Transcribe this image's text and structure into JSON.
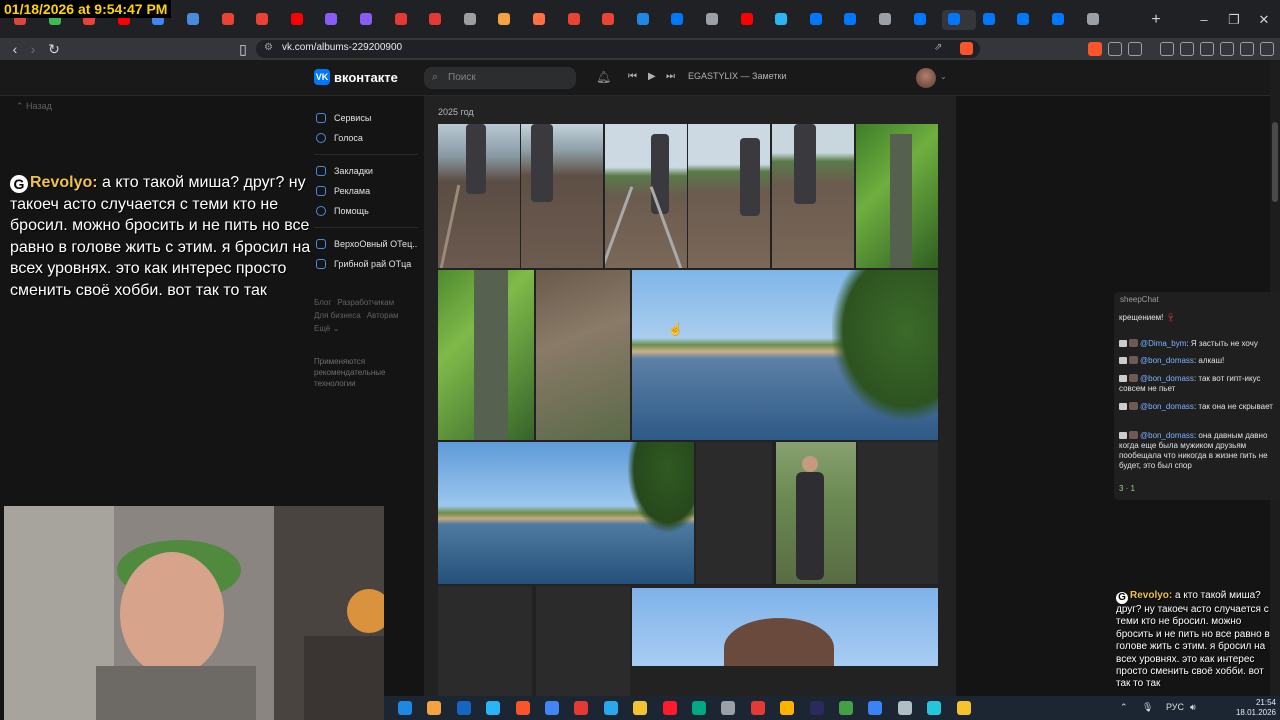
{
  "overlay_timestamp": "01/18/2026 at 9:54:47 PM",
  "browser": {
    "url": "vk.com/albums-229200900",
    "tabs": [
      {
        "color": "#d9483b"
      },
      {
        "color": "#3fb950"
      },
      {
        "color": "#ea4335"
      },
      {
        "color": "#ff0000"
      },
      {
        "color": "#4285f4"
      },
      {
        "color": "#4a8cdc"
      },
      {
        "color": "#ea4335"
      },
      {
        "color": "#ea4335"
      },
      {
        "color": "#ff0000"
      },
      {
        "color": "#8a5cf6"
      },
      {
        "color": "#8a5cf6"
      },
      {
        "color": "#e53935"
      },
      {
        "color": "#e53935"
      },
      {
        "color": "#9e9e9e"
      },
      {
        "color": "#f4a340"
      },
      {
        "color": "#ff7043"
      },
      {
        "color": "#ea4335"
      },
      {
        "color": "#ea4335"
      },
      {
        "color": "#1e88e5"
      },
      {
        "color": "#0077ff"
      },
      {
        "color": "#9aa0a6"
      },
      {
        "color": "#ff0000"
      },
      {
        "color": "#29b6f6"
      },
      {
        "color": "#0077ff"
      },
      {
        "color": "#0077ff"
      },
      {
        "color": "#9aa0a6"
      },
      {
        "color": "#0077ff"
      },
      {
        "color": "#0077ff"
      },
      {
        "color": "#0077ff"
      },
      {
        "color": "#0077ff"
      },
      {
        "color": "#0077ff"
      },
      {
        "color": "#9aa0a6"
      }
    ],
    "new_tab": "+",
    "window_controls": [
      "–",
      "❐",
      "✕"
    ]
  },
  "vk": {
    "brand": "вконтакте",
    "logo_text": "VK",
    "search_placeholder": "Поиск",
    "now_playing": "EGASTYLIX — Заметки",
    "back_link": "Назад",
    "menu": {
      "group1": [
        "Сервисы",
        "Голоса"
      ],
      "group2": [
        "Закладки",
        "Реклама",
        "Помощь"
      ],
      "group3": [
        "ВерхоОвный ОТец...",
        "Грибной рай ОТца"
      ]
    },
    "footer_links": [
      "Блог",
      "Разработчикам",
      "Для бизнеса",
      "Авторам",
      "Ещё ⌄"
    ],
    "footer_note": "Применяются рекомендательные технологии",
    "year_label": "2025 год"
  },
  "overlay_chat": {
    "name": "Revolyo",
    "message": "а кто такой миша? друг? ну такоеч асто случается с теми кто не бросил. можно бросить и не пить но все равно в голове жить с этим. я бросил на всех уровнях. это как интерес просто сменить своё хобби. вот так то так"
  },
  "chat_panel": {
    "title": "sheepChat",
    "first_line": "крещением!",
    "messages": [
      {
        "user": "@Dima_bym",
        "text": "Я застыть не хочу"
      },
      {
        "user": "@bon_domass",
        "text": "алкаш!"
      },
      {
        "user": "@bon_domass",
        "text": "так вот гипт-икус совсем не пьет"
      },
      {
        "user": "@bon_domass",
        "text": "так она не скрывает"
      },
      {
        "user": "@bon_domass",
        "text": "она давным давно когда еще была мужиком друзьям пообещала что никогда в жизне пить не будет, это был спор"
      }
    ],
    "stats": "3 · 1"
  },
  "bottom_chat": {
    "name": "Revolyo",
    "message": "а кто такой миша? друг? ну такоеч асто случается с теми кто не бросил. можно бросить и не пить но все равно в голове жить с этим. я бросил на всех уровнях. это как интерес просто сменить своё хобби. вот так то так"
  },
  "taskbar": {
    "icons": [
      {
        "color": "#1e88e5"
      },
      {
        "color": "#f4a340"
      },
      {
        "color": "#1565c0"
      },
      {
        "color": "#29b6f6"
      },
      {
        "color": "#fb542b"
      },
      {
        "color": "#4285f4"
      },
      {
        "color": "#e53935"
      },
      {
        "color": "#29a9eb"
      },
      {
        "color": "#f4c430"
      },
      {
        "color": "#ff1b2d"
      },
      {
        "color": "#00a884"
      },
      {
        "color": "#9aa0a6"
      },
      {
        "color": "#e53935"
      },
      {
        "color": "#ffb300"
      },
      {
        "color": "#2b2a5c"
      },
      {
        "color": "#43a047"
      },
      {
        "color": "#3b82f6"
      },
      {
        "color": "#b0bec5"
      },
      {
        "color": "#26c6da"
      },
      {
        "color": "#f4c430"
      }
    ],
    "language": "РУС",
    "time": "21:54",
    "date": "18.01.2026"
  }
}
